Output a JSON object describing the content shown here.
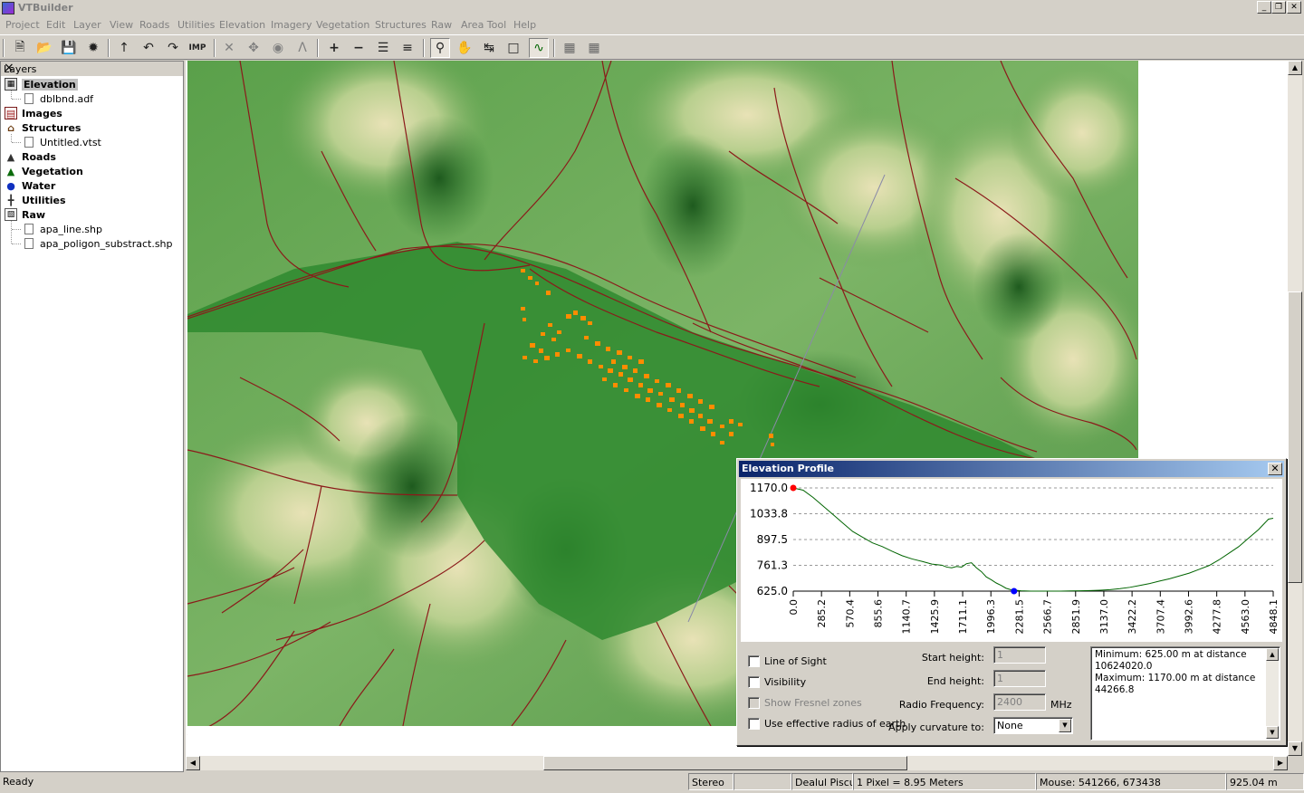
{
  "app": {
    "title": "VTBuilder"
  },
  "menu": [
    "Project",
    "Edit",
    "Layer",
    "View",
    "Roads",
    "Utilities",
    "Elevation",
    "Imagery",
    "Vegetation",
    "Structures",
    "Raw",
    "Area Tool",
    "Help"
  ],
  "layers_panel": {
    "title": "Layers",
    "items": [
      {
        "label": "Elevation",
        "type": "category",
        "icon": "elevation-icon"
      },
      {
        "label": "dblbnd.adf",
        "type": "file",
        "icon": "file-icon"
      },
      {
        "label": "Images",
        "type": "category",
        "icon": "images-icon"
      },
      {
        "label": "Structures",
        "type": "category",
        "icon": "structures-icon"
      },
      {
        "label": "Untitled.vtst",
        "type": "file",
        "icon": "file-icon"
      },
      {
        "label": "Roads",
        "type": "category",
        "icon": "roads-icon"
      },
      {
        "label": "Vegetation",
        "type": "category",
        "icon": "vegetation-icon"
      },
      {
        "label": "Water",
        "type": "category",
        "icon": "water-icon"
      },
      {
        "label": "Utilities",
        "type": "category",
        "icon": "utilities-icon"
      },
      {
        "label": "Raw",
        "type": "category",
        "icon": "raw-icon"
      },
      {
        "label": "apa_line.shp",
        "type": "file",
        "icon": "file-icon"
      },
      {
        "label": "apa_poligon_substract.shp",
        "type": "file",
        "icon": "file-icon"
      }
    ]
  },
  "status": {
    "ready": "Ready",
    "stereo": "Stereo",
    "location": "Dealul Piscul",
    "scale": "1 Pixel = 8.95 Meters",
    "mouse": "Mouse: 541266, 673438",
    "elevation": "925.04 m"
  },
  "elevation_profile": {
    "title": "Elevation Profile",
    "line_of_sight": "Line of Sight",
    "visibility": "Visibility",
    "show_fresnel": "Show Fresnel zones",
    "effective_radius": "Use effective radius of earth",
    "start_height_label": "Start height:",
    "start_height": "1",
    "end_height_label": "End height:",
    "end_height": "1",
    "radio_freq_label": "Radio Frequency:",
    "radio_freq": "2400",
    "radio_freq_unit": "MHz",
    "curvature_label": "Apply curvature to:",
    "curvature_value": "None",
    "info_lines": [
      "Minimum: 625.00 m at distance",
      "10624020.0",
      "Maximum: 1170.00 m at distance",
      "44266.8"
    ]
  },
  "chart_data": {
    "type": "line",
    "title": "",
    "xlabel": "",
    "ylabel": "",
    "ylim": [
      625.0,
      1170.0
    ],
    "xlim": [
      0.0,
      4848.1
    ],
    "y_ticks": [
      "1170.0",
      "1033.8",
      "897.5",
      "761.3",
      "625.0"
    ],
    "x_ticks": [
      "0.0",
      "285.2",
      "570.4",
      "855.6",
      "1140.7",
      "1425.9",
      "1711.1",
      "1996.3",
      "2281.5",
      "2566.7",
      "2851.9",
      "3137.0",
      "3422.2",
      "3707.4",
      "3992.6",
      "4277.8",
      "4563.0",
      "4848.1"
    ],
    "series": [
      {
        "color": "#006400",
        "x": [
          0,
          100,
          200,
          300,
          400,
          500,
          600,
          700,
          800,
          900,
          1000,
          1100,
          1200,
          1300,
          1400,
          1500,
          1550,
          1600,
          1650,
          1700,
          1750,
          1800,
          1850,
          1900,
          1950,
          2000,
          2050,
          2100,
          2150,
          2200,
          2300,
          2400,
          2500,
          2600,
          2700,
          2800,
          2900,
          3000,
          3100,
          3200,
          3300,
          3400,
          3500,
          3600,
          3700,
          3800,
          3900,
          4000,
          4100,
          4200,
          4300,
          4400,
          4500,
          4600,
          4700,
          4800,
          4848
        ],
        "y": [
          1170,
          1158,
          1120,
          1075,
          1030,
          985,
          940,
          910,
          880,
          860,
          835,
          812,
          795,
          782,
          768,
          762,
          752,
          748,
          755,
          752,
          770,
          775,
          748,
          728,
          700,
          685,
          668,
          655,
          640,
          632,
          627,
          625,
          625,
          625,
          625,
          626,
          627,
          628,
          630,
          633,
          638,
          645,
          655,
          665,
          678,
          690,
          705,
          720,
          740,
          760,
          790,
          825,
          860,
          905,
          950,
          1005,
          1010
        ]
      }
    ],
    "markers": [
      {
        "x": 0,
        "y": 1170,
        "color": "#ff0000"
      },
      {
        "x": 2230,
        "y": 625,
        "color": "#0000ff"
      }
    ]
  }
}
